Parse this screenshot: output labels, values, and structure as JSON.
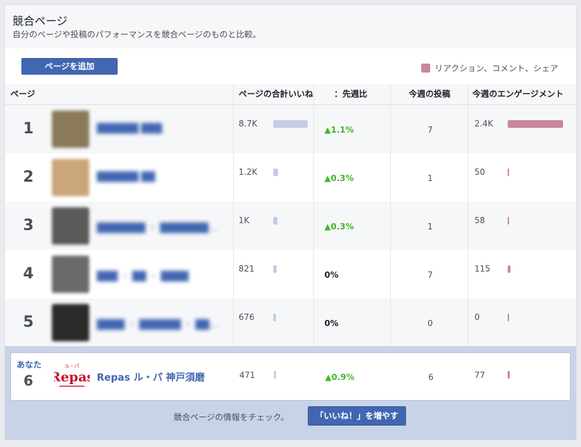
{
  "header": {
    "title": "競合ページ",
    "subtitle": "自分のページや投稿のパフォーマンスを競合ページのものと比較。"
  },
  "toolbar": {
    "add_label": "ページを追加",
    "legend_label": "リアクション、コメント、シェア"
  },
  "columns": [
    "ページ",
    "ページの合計いいね",
    "：先週比",
    "今週の投稿",
    "今週のエンゲージメント"
  ],
  "rows": [
    {
      "rank": "1",
      "name": "██████ ███",
      "likes": "8.7K",
      "likes_fraction": 1.0,
      "change": "▲1.1%",
      "trend": "up",
      "posts": "7",
      "engagement": "2.4K",
      "eng_fraction": 1.0
    },
    {
      "rank": "2",
      "name": "██████ ██",
      "likes": "1.2K",
      "likes_fraction": 0.14,
      "change": "▲0.3%",
      "trend": "up",
      "posts": "1",
      "engagement": "50",
      "eng_fraction": 0.02
    },
    {
      "rank": "3",
      "name": "███████ ・ ███████…",
      "likes": "1K",
      "likes_fraction": 0.12,
      "change": "▲0.3%",
      "trend": "up",
      "posts": "1",
      "engagement": "58",
      "eng_fraction": 0.024
    },
    {
      "rank": "4",
      "name": "███ ・ ██ ・ ████",
      "likes": "821",
      "likes_fraction": 0.094,
      "change": "0%",
      "trend": "flat",
      "posts": "7",
      "engagement": "115",
      "eng_fraction": 0.048
    },
    {
      "rank": "5",
      "name": "████ ・ ██████ ・ ██…",
      "likes": "676",
      "likes_fraction": 0.078,
      "change": "0%",
      "trend": "flat",
      "posts": "0",
      "engagement": "0",
      "eng_fraction": 0.0
    }
  ],
  "you": {
    "label": "あなた",
    "rank": "6",
    "name": "Repas ル・パ 神戸須磨",
    "likes": "471",
    "likes_fraction": 0.054,
    "change": "▲0.9%",
    "trend": "up",
    "posts": "6",
    "engagement": "77",
    "eng_fraction": 0.032,
    "logo_text": "Repas",
    "logo_small": "ル・パ"
  },
  "footer": {
    "text": "競合ページの情報をチェック。",
    "button_label": "「いいね！」を増やす"
  },
  "colors": {
    "accent": "#4267b2",
    "likes_bar": "#c5cce2",
    "engagement_bar": "#c9879c",
    "up": "#42b72a"
  },
  "thumbs": [
    "#8a7a5a",
    "#c9a77a",
    "#5a5a5a",
    "#6a6a6a",
    "#2a2a2a"
  ]
}
